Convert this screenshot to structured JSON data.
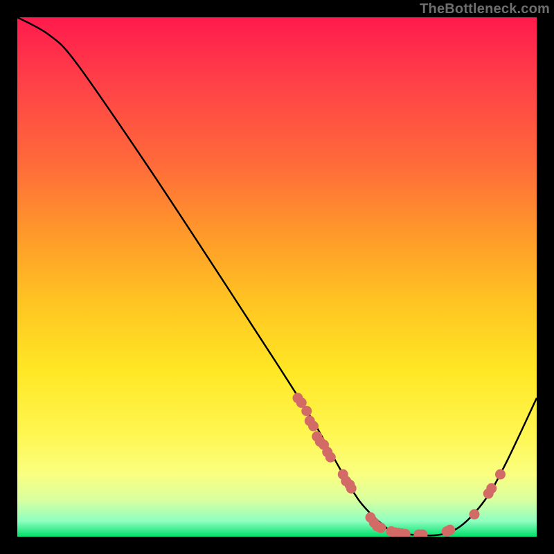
{
  "watermark": "TheBottleneck.com",
  "chart_data": {
    "type": "line",
    "title": "",
    "xlabel": "",
    "ylabel": "",
    "xlim": [
      0,
      100
    ],
    "ylim": [
      0,
      100
    ],
    "legend": null,
    "grid": false,
    "series": [
      {
        "name": "bottleneck-curve",
        "points": [
          {
            "x": 0.0,
            "y": 100.0
          },
          {
            "x": 6.0,
            "y": 96.7
          },
          {
            "x": 11.3,
            "y": 91.3
          },
          {
            "x": 25.0,
            "y": 71.5
          },
          {
            "x": 40.0,
            "y": 48.7
          },
          {
            "x": 50.0,
            "y": 33.3
          },
          {
            "x": 56.7,
            "y": 22.7
          },
          {
            "x": 62.0,
            "y": 13.3
          },
          {
            "x": 66.0,
            "y": 6.7
          },
          {
            "x": 70.7,
            "y": 2.0
          },
          {
            "x": 73.3,
            "y": 0.7
          },
          {
            "x": 80.7,
            "y": 0.3
          },
          {
            "x": 85.3,
            "y": 2.0
          },
          {
            "x": 90.0,
            "y": 7.0
          },
          {
            "x": 94.0,
            "y": 14.0
          },
          {
            "x": 100.0,
            "y": 26.7
          }
        ]
      }
    ],
    "scatter_points": [
      {
        "x": 54.0,
        "y": 26.7
      },
      {
        "x": 54.7,
        "y": 25.8
      },
      {
        "x": 55.7,
        "y": 24.2
      },
      {
        "x": 56.3,
        "y": 22.3
      },
      {
        "x": 57.0,
        "y": 21.3
      },
      {
        "x": 57.7,
        "y": 19.3
      },
      {
        "x": 58.3,
        "y": 18.3
      },
      {
        "x": 59.0,
        "y": 17.7
      },
      {
        "x": 59.7,
        "y": 16.3
      },
      {
        "x": 60.3,
        "y": 15.3
      },
      {
        "x": 62.7,
        "y": 12.0
      },
      {
        "x": 63.3,
        "y": 10.7
      },
      {
        "x": 64.0,
        "y": 10.0
      },
      {
        "x": 64.3,
        "y": 9.3
      },
      {
        "x": 68.0,
        "y": 3.7
      },
      {
        "x": 68.7,
        "y": 2.7
      },
      {
        "x": 69.3,
        "y": 2.0
      },
      {
        "x": 70.0,
        "y": 1.7
      },
      {
        "x": 72.0,
        "y": 1.0
      },
      {
        "x": 72.7,
        "y": 0.8
      },
      {
        "x": 73.3,
        "y": 0.7
      },
      {
        "x": 74.0,
        "y": 0.6
      },
      {
        "x": 74.7,
        "y": 0.5
      },
      {
        "x": 77.3,
        "y": 0.4
      },
      {
        "x": 78.0,
        "y": 0.4
      },
      {
        "x": 82.7,
        "y": 1.0
      },
      {
        "x": 83.3,
        "y": 1.3
      },
      {
        "x": 88.0,
        "y": 4.3
      },
      {
        "x": 90.7,
        "y": 8.3
      },
      {
        "x": 91.3,
        "y": 9.3
      },
      {
        "x": 93.0,
        "y": 12.0
      }
    ],
    "scatter_color": "#d26a66",
    "curve_color": "#000000"
  }
}
